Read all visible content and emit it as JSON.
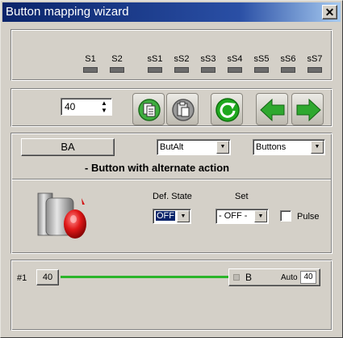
{
  "window": {
    "title": "Button mapping wizard"
  },
  "sequence": {
    "labels": [
      "S1",
      "S2",
      "sS1",
      "sS2",
      "sS3",
      "sS4",
      "sS5",
      "sS6",
      "sS7"
    ]
  },
  "toolbar": {
    "spin_value": "40",
    "copy_icon": "copy-icon",
    "paste_icon": "paste-icon",
    "refresh_icon": "refresh-icon",
    "back_icon": "arrow-left-icon",
    "forward_icon": "arrow-right-icon"
  },
  "button_config": {
    "name_button": "BA",
    "type_select": "ButAlt",
    "category_select": "Buttons",
    "description": "- Button with alternate action",
    "image": "pushbutton-image",
    "def_state_label": "Def. State",
    "def_state_value": "OFF",
    "set_label": "Set",
    "set_value": "- OFF -",
    "pulse_label": "Pulse",
    "pulse_checked": false
  },
  "mapping": {
    "index_label": "#1",
    "left_value": "40",
    "handle_label": "B",
    "auto_label": "Auto",
    "auto_value": "40",
    "line_color": "#2bb52b"
  }
}
